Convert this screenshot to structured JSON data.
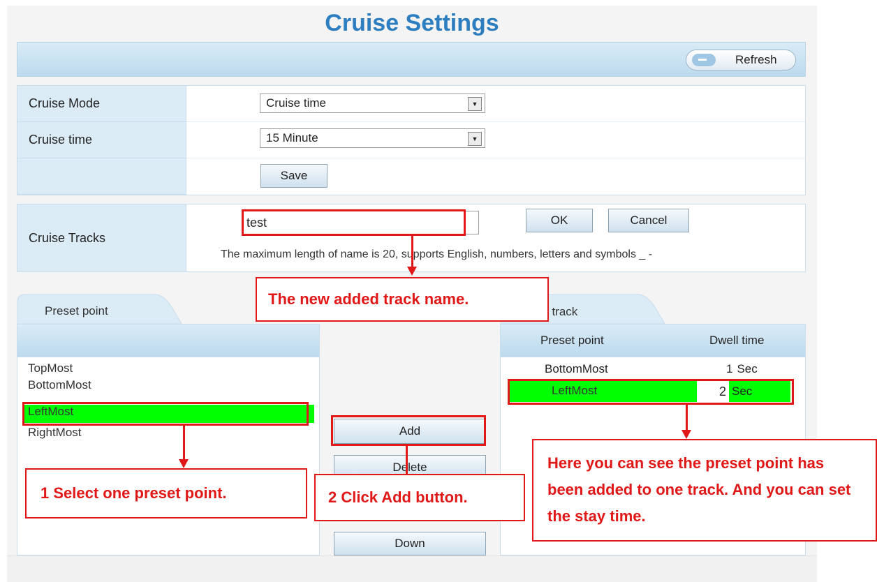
{
  "page": {
    "title": "Cruise Settings",
    "refresh_label": "Refresh"
  },
  "settings": {
    "cruise_mode_label": "Cruise Mode",
    "cruise_mode_value": "Cruise time",
    "cruise_time_label": "Cruise time",
    "cruise_time_value": "15 Minute",
    "save_label": "Save"
  },
  "tracks": {
    "label": "Cruise Tracks",
    "name_value": "test",
    "ok_label": "OK",
    "cancel_label": "Cancel",
    "hint": "The maximum length of name is 20, supports English, numbers, letters and symbols _ -"
  },
  "preset_panel": {
    "tab_label": "Preset point",
    "items": [
      "TopMost",
      "BottomMost",
      "LeftMost",
      "RightMost"
    ],
    "selected_index": 2
  },
  "actions": {
    "add_label": "Add",
    "delete_label": "Delete",
    "down_label": "Down"
  },
  "track_panel": {
    "tab_label": "ise track",
    "col_preset": "Preset point",
    "col_dwell": "Dwell time",
    "rows": [
      {
        "preset": "BottomMost",
        "dwell": "1",
        "unit": "Sec"
      },
      {
        "preset": "LeftMost",
        "dwell": "2",
        "unit": "Sec"
      }
    ]
  },
  "annotations": {
    "track_name": "The new added track name.",
    "select_point": "1 Select one preset point.",
    "click_add": "2 Click Add button.",
    "added_info": "Here you can see the preset point has been added to one track. And you can set the stay time."
  },
  "colors": {
    "accent_title": "#2d7ec0",
    "highlight": "#00ff00",
    "annotation": "#e01818"
  }
}
